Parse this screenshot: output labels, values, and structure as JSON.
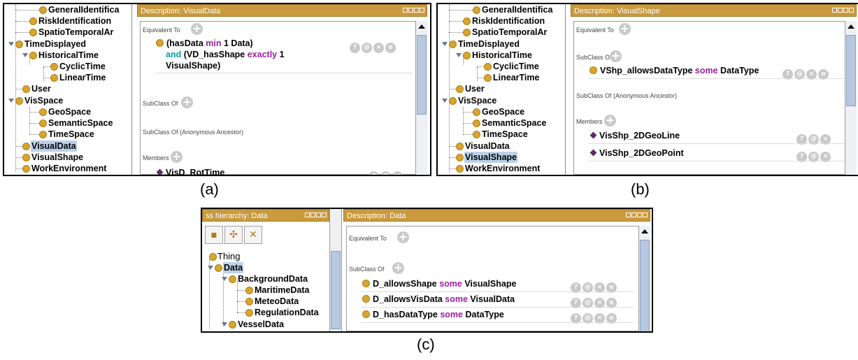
{
  "panel_a": {
    "tree": {
      "GeneralIdentifica": "GeneralIdentifica",
      "RiskIdentification": "RiskIdentification",
      "SpatioTemporalAr": "SpatioTemporalAr",
      "TimeDisplayed": "TimeDisplayed",
      "HistoricalTime": "HistoricalTime",
      "CyclicTime": "CyclicTime",
      "LinearTime": "LinearTime",
      "User": "User",
      "VisSpace": "VisSpace",
      "GeoSpace": "GeoSpace",
      "SemanticSpace": "SemanticSpace",
      "TimeSpace": "TimeSpace",
      "VisualData": "VisualData",
      "VisualShape": "VisualShape",
      "WorkEnvironment": "WorkEnvironment"
    },
    "title": "Description: VisualData",
    "equivalent_to": "Equivalent To",
    "expr": {
      "line1_a": "(hasData ",
      "line1_kw": "min",
      "line1_b": " 1 Data)",
      "line2_and": "and",
      "line2_a": " (VD_hasShape ",
      "line2_kw": "exactly",
      "line2_b": " 1",
      "line3": "VisualShape)"
    },
    "subclass_of": "SubClass Of",
    "anon": "SubClass Of (Anonymous Ancestor)",
    "members": "Members",
    "member1": "VisD_RotTime",
    "caption": "(a)"
  },
  "panel_b": {
    "tree": {
      "GeneralIdentifica": "GeneralIdentifica",
      "RiskIdentification": "RiskIdentification",
      "SpatioTemporalAr": "SpatioTemporalAr",
      "TimeDisplayed": "TimeDisplayed",
      "HistoricalTime": "HistoricalTime",
      "CyclicTime": "CyclicTime",
      "LinearTime": "LinearTime",
      "User": "User",
      "VisSpace": "VisSpace",
      "GeoSpace": "GeoSpace",
      "SemanticSpace": "SemanticSpace",
      "TimeSpace": "TimeSpace",
      "VisualData": "VisualData",
      "VisualShape": "VisualShape",
      "WorkEnvironment": "WorkEnvironment"
    },
    "title": "Description: VisualShape",
    "equivalent_to": "Equivalent To",
    "subclass_of": "SubClass Of",
    "sub1_a": "VShp_allowsDataType ",
    "sub1_kw": "some",
    "sub1_b": " DataType",
    "anon": "SubClass Of (Anonymous Ancestor)",
    "members": "Members",
    "member1": "VisShp_2DGeoLine",
    "member2": "VisShp_2DGeoPoint",
    "caption": "(b)"
  },
  "panel_c": {
    "hier_title": "ss hierarchy: Data",
    "tree": {
      "Thing": "Thing",
      "Data": "Data",
      "BackgroundData": "BackgroundData",
      "MaritimeData": "MaritimeData",
      "MeteoData": "MeteoData",
      "RegulationData": "RegulationData",
      "VesselData": "VesselData"
    },
    "title": "Description: Data",
    "equivalent_to": "Equivalent To",
    "subclass_of": "SubClass Of",
    "rows": [
      {
        "a": "D_allowsShape ",
        "kw": "some",
        "b": " VisualShape"
      },
      {
        "a": "D_allowsVisData ",
        "kw": "some",
        "b": " VisualData"
      },
      {
        "a": "D_hasDataType ",
        "kw": "some",
        "b": " DataType"
      }
    ],
    "caption": "(c)"
  },
  "buttons": {
    "help": "?",
    "at": "@",
    "x": "×",
    "o": "o"
  },
  "colors": {
    "titlebar": "#c99a3e",
    "class_dot": "#d8a530",
    "keyword": "#a020a0",
    "and": "#00a0a0",
    "selection": "#bcd0e8"
  }
}
